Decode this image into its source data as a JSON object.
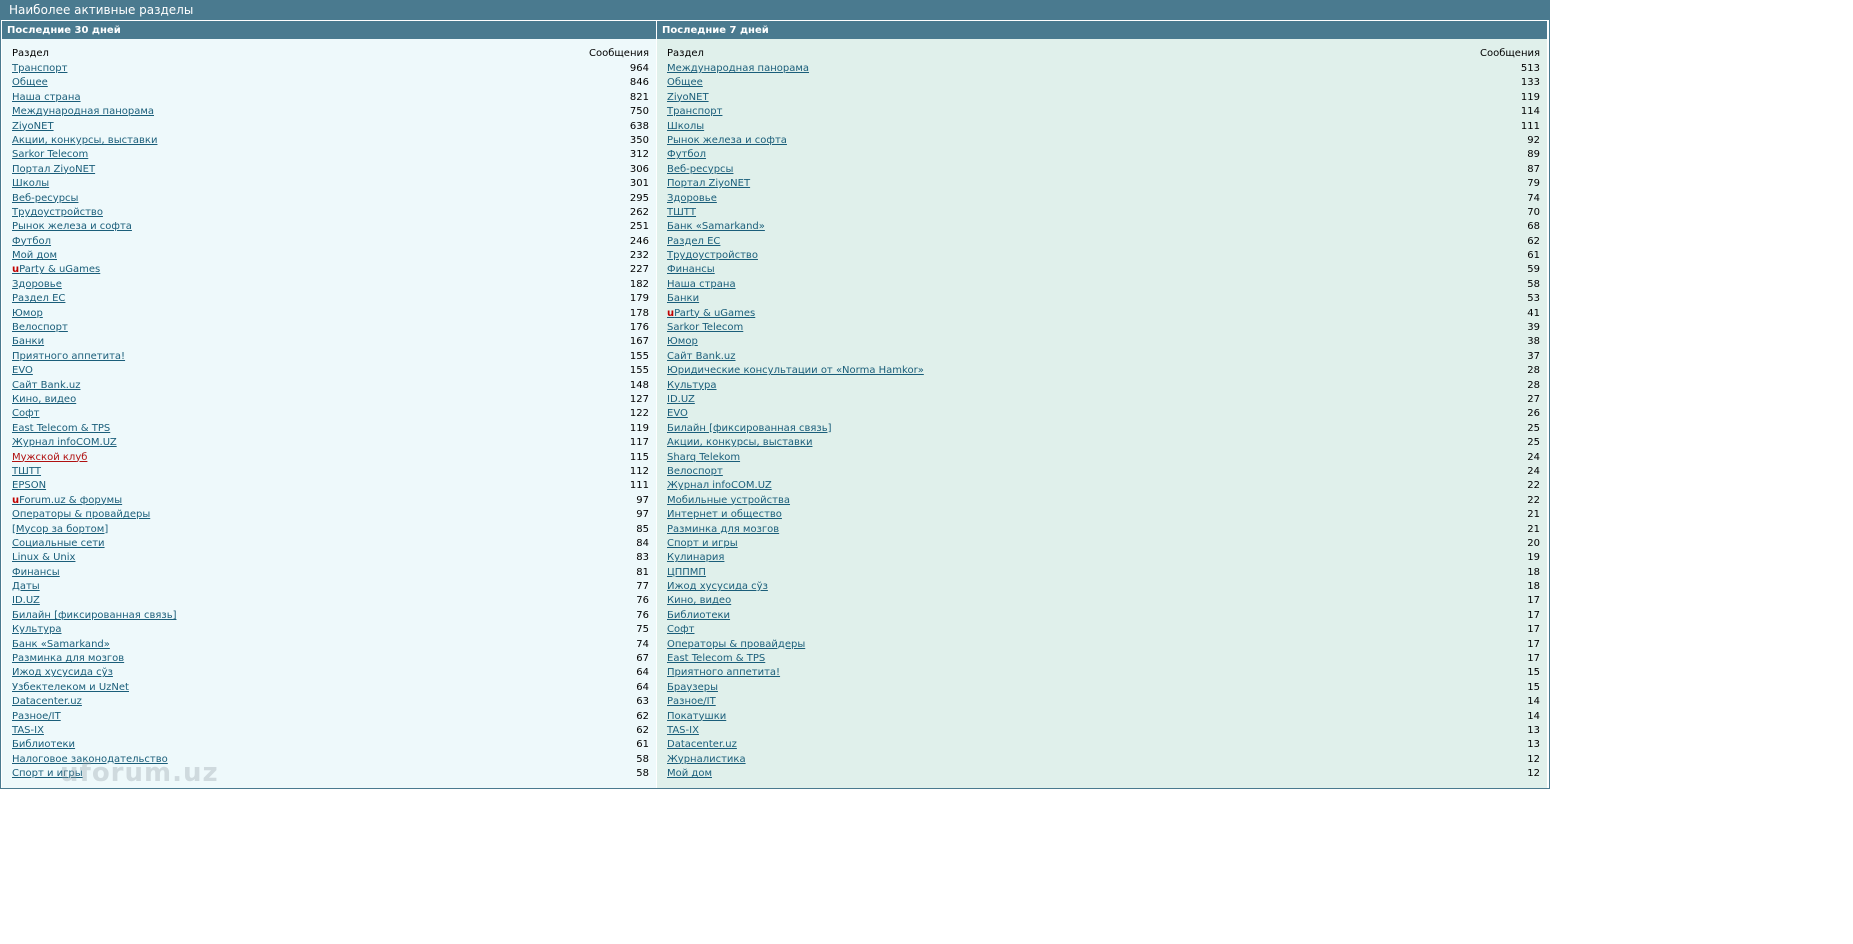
{
  "title": "Наиболее активные разделы",
  "watermark": "uforum.uz",
  "left": {
    "header": "Последние 30 дней",
    "col_name": "Раздел",
    "col_count": "Сообщения",
    "rows": [
      {
        "name": "Транспорт",
        "count": "964"
      },
      {
        "name": "Общее",
        "count": "846"
      },
      {
        "name": "Наша страна",
        "count": "821"
      },
      {
        "name": "Международная панорама",
        "count": "750"
      },
      {
        "name": "ZiyoNET",
        "count": "638"
      },
      {
        "name": "Акции, конкурсы, выставки",
        "count": "350"
      },
      {
        "name": "Sarkor Telecom",
        "count": "312"
      },
      {
        "name": "Портал ZiyoNET",
        "count": "306"
      },
      {
        "name": "Школы",
        "count": "301"
      },
      {
        "name": "Веб-ресурсы",
        "count": "295"
      },
      {
        "name": "Трудоустройство",
        "count": "262"
      },
      {
        "name": "Рынок железа и софта",
        "count": "251"
      },
      {
        "name": "Футбол",
        "count": "246"
      },
      {
        "name": "Мой дом",
        "count": "232"
      },
      {
        "prefix": "u",
        "name": "Party & uGames",
        "count": "227"
      },
      {
        "name": "Здоровье",
        "count": "182"
      },
      {
        "name": "Раздел ЕС",
        "count": "179"
      },
      {
        "name": "Юмор",
        "count": "178"
      },
      {
        "name": "Велоспорт",
        "count": "176"
      },
      {
        "name": "Банки",
        "count": "167"
      },
      {
        "name": "Приятного аппетита!",
        "count": "155"
      },
      {
        "name": "EVO",
        "count": "155"
      },
      {
        "name": "Сайт Bank.uz",
        "count": "148"
      },
      {
        "name": "Кино, видео",
        "count": "127"
      },
      {
        "name": "Софт",
        "count": "122"
      },
      {
        "name": "East Telecom & TPS",
        "count": "119"
      },
      {
        "name": "Журнал infoCOM.UZ",
        "count": "117"
      },
      {
        "name": "Мужской клуб",
        "count": "115",
        "red": true
      },
      {
        "name": "ТШТТ",
        "count": "112"
      },
      {
        "name": "EPSON",
        "count": "111"
      },
      {
        "prefix": "u",
        "name": "Forum.uz & форумы",
        "count": "97"
      },
      {
        "name": "Операторы & провайдеры",
        "count": "97"
      },
      {
        "name": "[Мусор за бортом]",
        "count": "85"
      },
      {
        "name": "Социальные сети",
        "count": "84"
      },
      {
        "name": "Linux & Unix",
        "count": "83"
      },
      {
        "name": "Финансы",
        "count": "81"
      },
      {
        "name": "Даты",
        "count": "77"
      },
      {
        "name": "ID.UZ",
        "count": "76"
      },
      {
        "name": "Билайн [фиксированная связь]",
        "count": "76"
      },
      {
        "name": "Культура",
        "count": "75"
      },
      {
        "name": "Банк «Samarkand»",
        "count": "74"
      },
      {
        "name": "Разминка для мозгов",
        "count": "67"
      },
      {
        "name": "Ижод хусусида сўз",
        "count": "64"
      },
      {
        "name": "Узбектелеком и UzNet",
        "count": "64"
      },
      {
        "name": "Datacenter.uz",
        "count": "63"
      },
      {
        "name": "Разное/IT",
        "count": "62"
      },
      {
        "name": "TAS-IX",
        "count": "62"
      },
      {
        "name": "Библиотеки",
        "count": "61"
      },
      {
        "name": "Налоговое законодательство",
        "count": "58"
      },
      {
        "name": "Спорт и игры",
        "count": "58"
      }
    ]
  },
  "right": {
    "header": "Последние 7 дней",
    "col_name": "Раздел",
    "col_count": "Сообщения",
    "rows": [
      {
        "name": "Международная панорама",
        "count": "513"
      },
      {
        "name": "Общее",
        "count": "133"
      },
      {
        "name": "ZiyoNET",
        "count": "119"
      },
      {
        "name": "Транспорт",
        "count": "114"
      },
      {
        "name": "Школы",
        "count": "111"
      },
      {
        "name": "Рынок железа и софта",
        "count": "92"
      },
      {
        "name": "Футбол",
        "count": "89"
      },
      {
        "name": "Веб-ресурсы",
        "count": "87"
      },
      {
        "name": "Портал ZiyoNET",
        "count": "79"
      },
      {
        "name": "Здоровье",
        "count": "74"
      },
      {
        "name": "ТШТТ",
        "count": "70"
      },
      {
        "name": "Банк «Samarkand»",
        "count": "68"
      },
      {
        "name": "Раздел ЕС",
        "count": "62"
      },
      {
        "name": "Трудоустройство",
        "count": "61"
      },
      {
        "name": "Финансы",
        "count": "59"
      },
      {
        "name": "Наша страна",
        "count": "58"
      },
      {
        "name": "Банки",
        "count": "53"
      },
      {
        "prefix": "u",
        "name": "Party & uGames",
        "count": "41"
      },
      {
        "name": "Sarkor Telecom",
        "count": "39"
      },
      {
        "name": "Юмор",
        "count": "38"
      },
      {
        "name": "Сайт Bank.uz",
        "count": "37"
      },
      {
        "name": "Юридические консультации от «Norma Hamkor»",
        "count": "28"
      },
      {
        "name": "Культура",
        "count": "28"
      },
      {
        "name": "ID.UZ",
        "count": "27"
      },
      {
        "name": "EVO",
        "count": "26"
      },
      {
        "name": "Билайн [фиксированная связь]",
        "count": "25"
      },
      {
        "name": "Акции, конкурсы, выставки",
        "count": "25"
      },
      {
        "name": "Sharq Telekom",
        "count": "24"
      },
      {
        "name": "Велоспорт",
        "count": "24"
      },
      {
        "name": "Журнал infoCOM.UZ",
        "count": "22"
      },
      {
        "name": "Мобильные устройства",
        "count": "22"
      },
      {
        "name": "Интернет и общество",
        "count": "21"
      },
      {
        "name": "Разминка для мозгов",
        "count": "21"
      },
      {
        "name": "Спорт и игры",
        "count": "20"
      },
      {
        "name": "Кулинария",
        "count": "19"
      },
      {
        "name": "ЦППМП",
        "count": "18"
      },
      {
        "name": "Ижод хусусида сўз",
        "count": "18"
      },
      {
        "name": "Кино, видео",
        "count": "17"
      },
      {
        "name": "Библиотеки",
        "count": "17"
      },
      {
        "name": "Софт",
        "count": "17"
      },
      {
        "name": "Операторы & провайдеры",
        "count": "17"
      },
      {
        "name": "East Telecom & TPS",
        "count": "17"
      },
      {
        "name": "Приятного аппетита!",
        "count": "15"
      },
      {
        "name": "Браузеры",
        "count": "15"
      },
      {
        "name": "Разное/IT",
        "count": "14"
      },
      {
        "name": "Покатушки",
        "count": "14"
      },
      {
        "name": "TAS-IX",
        "count": "13"
      },
      {
        "name": "Datacenter.uz",
        "count": "13"
      },
      {
        "name": "Журналистика",
        "count": "12"
      },
      {
        "name": "Мой дом",
        "count": "12"
      }
    ]
  }
}
